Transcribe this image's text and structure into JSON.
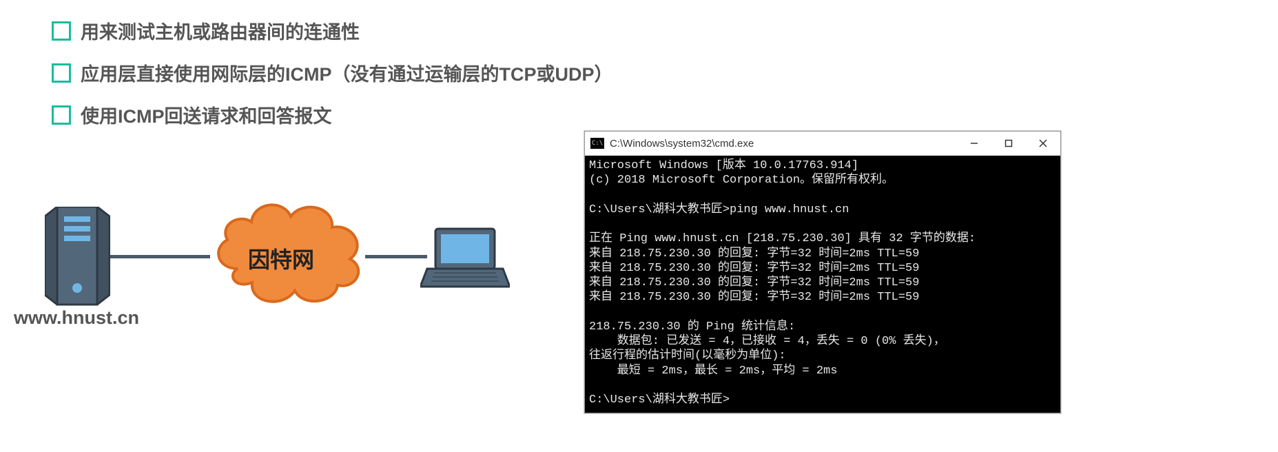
{
  "bullets": [
    "用来测试主机或路由器间的连通性",
    "应用层直接使用网际层的ICMP（没有通过运输层的TCP或UDP）",
    "使用ICMP回送请求和回答报文"
  ],
  "diagram": {
    "server_label": "www.hnust.cn",
    "cloud_label": "因特网"
  },
  "cmd": {
    "icon_text": "C:\\",
    "title": "C:\\Windows\\system32\\cmd.exe",
    "lines": [
      "Microsoft Windows [版本 10.0.17763.914]",
      "(c) 2018 Microsoft Corporation。保留所有权利。",
      "",
      "C:\\Users\\湖科大教书匠>ping www.hnust.cn",
      "",
      "正在 Ping www.hnust.cn [218.75.230.30] 具有 32 字节的数据:",
      "来自 218.75.230.30 的回复: 字节=32 时间=2ms TTL=59",
      "来自 218.75.230.30 的回复: 字节=32 时间=2ms TTL=59",
      "来自 218.75.230.30 的回复: 字节=32 时间=2ms TTL=59",
      "来自 218.75.230.30 的回复: 字节=32 时间=2ms TTL=59",
      "",
      "218.75.230.30 的 Ping 统计信息:",
      "    数据包: 已发送 = 4，已接收 = 4，丢失 = 0 (0% 丢失)，",
      "往返行程的估计时间(以毫秒为单位):",
      "    最短 = 2ms，最长 = 2ms，平均 = 2ms",
      "",
      "C:\\Users\\湖科大教书匠>"
    ]
  }
}
